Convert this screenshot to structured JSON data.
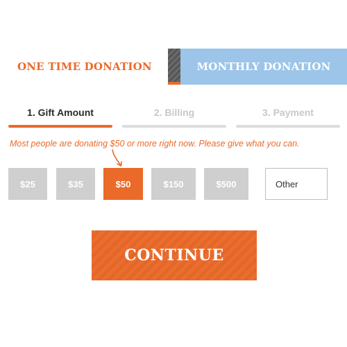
{
  "tabs": {
    "one_time": "ONE TIME DONATION",
    "monthly": "MONTHLY DONATION"
  },
  "steps": [
    {
      "label": "1. Gift Amount",
      "state": "active"
    },
    {
      "label": "2. Billing",
      "state": "inactive"
    },
    {
      "label": "3. Payment",
      "state": "inactive"
    }
  ],
  "helper_text": "Most people are donating $50 or more right now. Please give what you can.",
  "amounts": [
    {
      "label": "$25",
      "selected": false
    },
    {
      "label": "$35",
      "selected": false
    },
    {
      "label": "$50",
      "selected": true
    },
    {
      "label": "$150",
      "selected": false
    },
    {
      "label": "$500",
      "selected": false
    }
  ],
  "other_placeholder": "Other",
  "continue_label": "CONTINUE",
  "colors": {
    "accent": "#ea6a2a",
    "monthly_tab": "#9cc5e9",
    "amount_default": "#cfcfcf",
    "inactive_step": "#c8c8c8"
  },
  "icons": {
    "helper_arrow": "curved-arrow-down-icon"
  }
}
